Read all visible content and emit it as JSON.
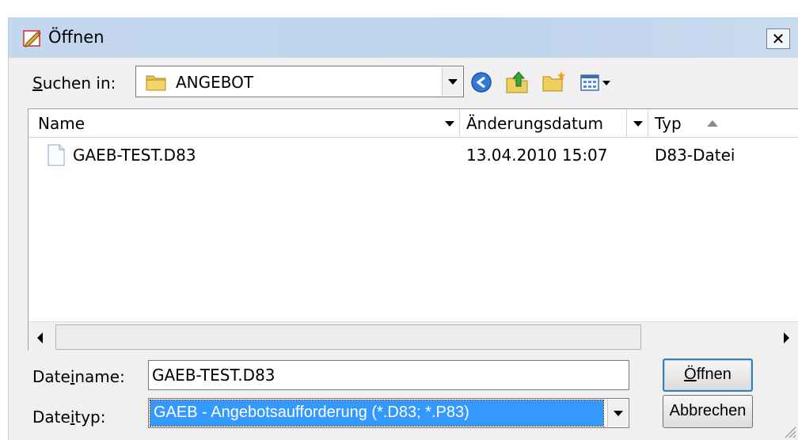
{
  "window": {
    "title": "Öffnen",
    "close_glyph": "✕",
    "title_icon": "open-dialog-pencil-icon"
  },
  "lookin": {
    "label_prefix": "",
    "label_mnemonic": "S",
    "label_rest": "uchen in:",
    "value": "ANGEBOT",
    "value_icon": "folder-icon"
  },
  "toolbar": {
    "back": "back-icon",
    "up": "up-folder-icon",
    "new_folder": "new-folder-icon",
    "view_menu": "view-menu-icon"
  },
  "list": {
    "columns": [
      {
        "label": "Name"
      },
      {
        "label": "Änderungsdatum"
      },
      {
        "label": "Typ"
      }
    ],
    "rows": [
      {
        "name": "GAEB-TEST.D83",
        "date": "13.04.2010 15:07",
        "type": "D83-Datei"
      }
    ]
  },
  "filename": {
    "label_prefix": "Date",
    "label_mnemonic": "i",
    "label_rest": "name:",
    "value": "GAEB-TEST.D83"
  },
  "filetype": {
    "label_prefix": "Date",
    "label_mnemonic": "i",
    "label_rest": "typ:",
    "value": "GAEB - Angebotsaufforderung (*.D83; *.P83)"
  },
  "buttons": {
    "open_mnemonic": "Ö",
    "open_rest": "ffnen",
    "cancel": "Abbrechen"
  },
  "colors": {
    "selection": "#3399ff",
    "titlebar": "#c4d7ef",
    "default_button_border": "#3c7fb1"
  }
}
